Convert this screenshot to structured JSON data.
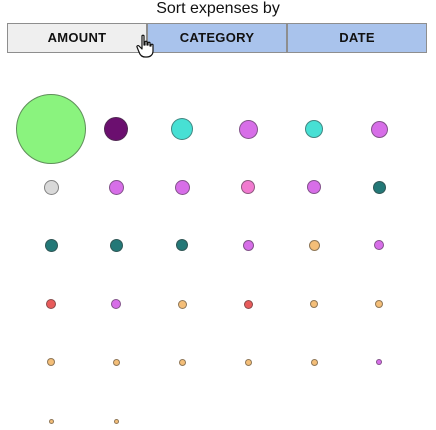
{
  "header": {
    "title": "Sort expenses by"
  },
  "sort_controls": {
    "buttons": [
      {
        "label": "AMOUNT",
        "state": "active"
      },
      {
        "label": "CATEGORY",
        "state": "inactive"
      },
      {
        "label": "DATE",
        "state": "inactive"
      }
    ]
  },
  "colors": {
    "active_button": "#efefef",
    "inactive_button": "#a9c3ec",
    "button_border": "#8e8e8e"
  },
  "bubbles": [
    {
      "color": "#8af37e"
    },
    {
      "color": "#6b0f6f"
    },
    {
      "color": "#47e0d4"
    },
    {
      "color": "#d76ee8"
    },
    {
      "color": "#47e0d4"
    },
    {
      "color": "#d76ee8"
    },
    {
      "color": "#d9d9d9"
    },
    {
      "color": "#d76ee8"
    },
    {
      "color": "#d76ee8"
    },
    {
      "color": "#f17ad0"
    },
    {
      "color": "#d76ee8"
    },
    {
      "color": "#237877"
    },
    {
      "color": "#237877"
    },
    {
      "color": "#237877"
    },
    {
      "color": "#237877"
    },
    {
      "color": "#d76ee8"
    },
    {
      "color": "#f4be78"
    },
    {
      "color": "#d76ee8"
    },
    {
      "color": "#e85b5b"
    },
    {
      "color": "#d76ee8"
    },
    {
      "color": "#f4be78"
    },
    {
      "color": "#e85b5b"
    },
    {
      "color": "#f4be78"
    },
    {
      "color": "#f4be78"
    },
    {
      "color": "#f4be78"
    },
    {
      "color": "#f4be78"
    },
    {
      "color": "#f4be78"
    },
    {
      "color": "#f4be78"
    },
    {
      "color": "#f4be78"
    },
    {
      "color": "#d76ee8"
    },
    {
      "color": "#f4be78"
    },
    {
      "color": "#f4be78"
    }
  ]
}
